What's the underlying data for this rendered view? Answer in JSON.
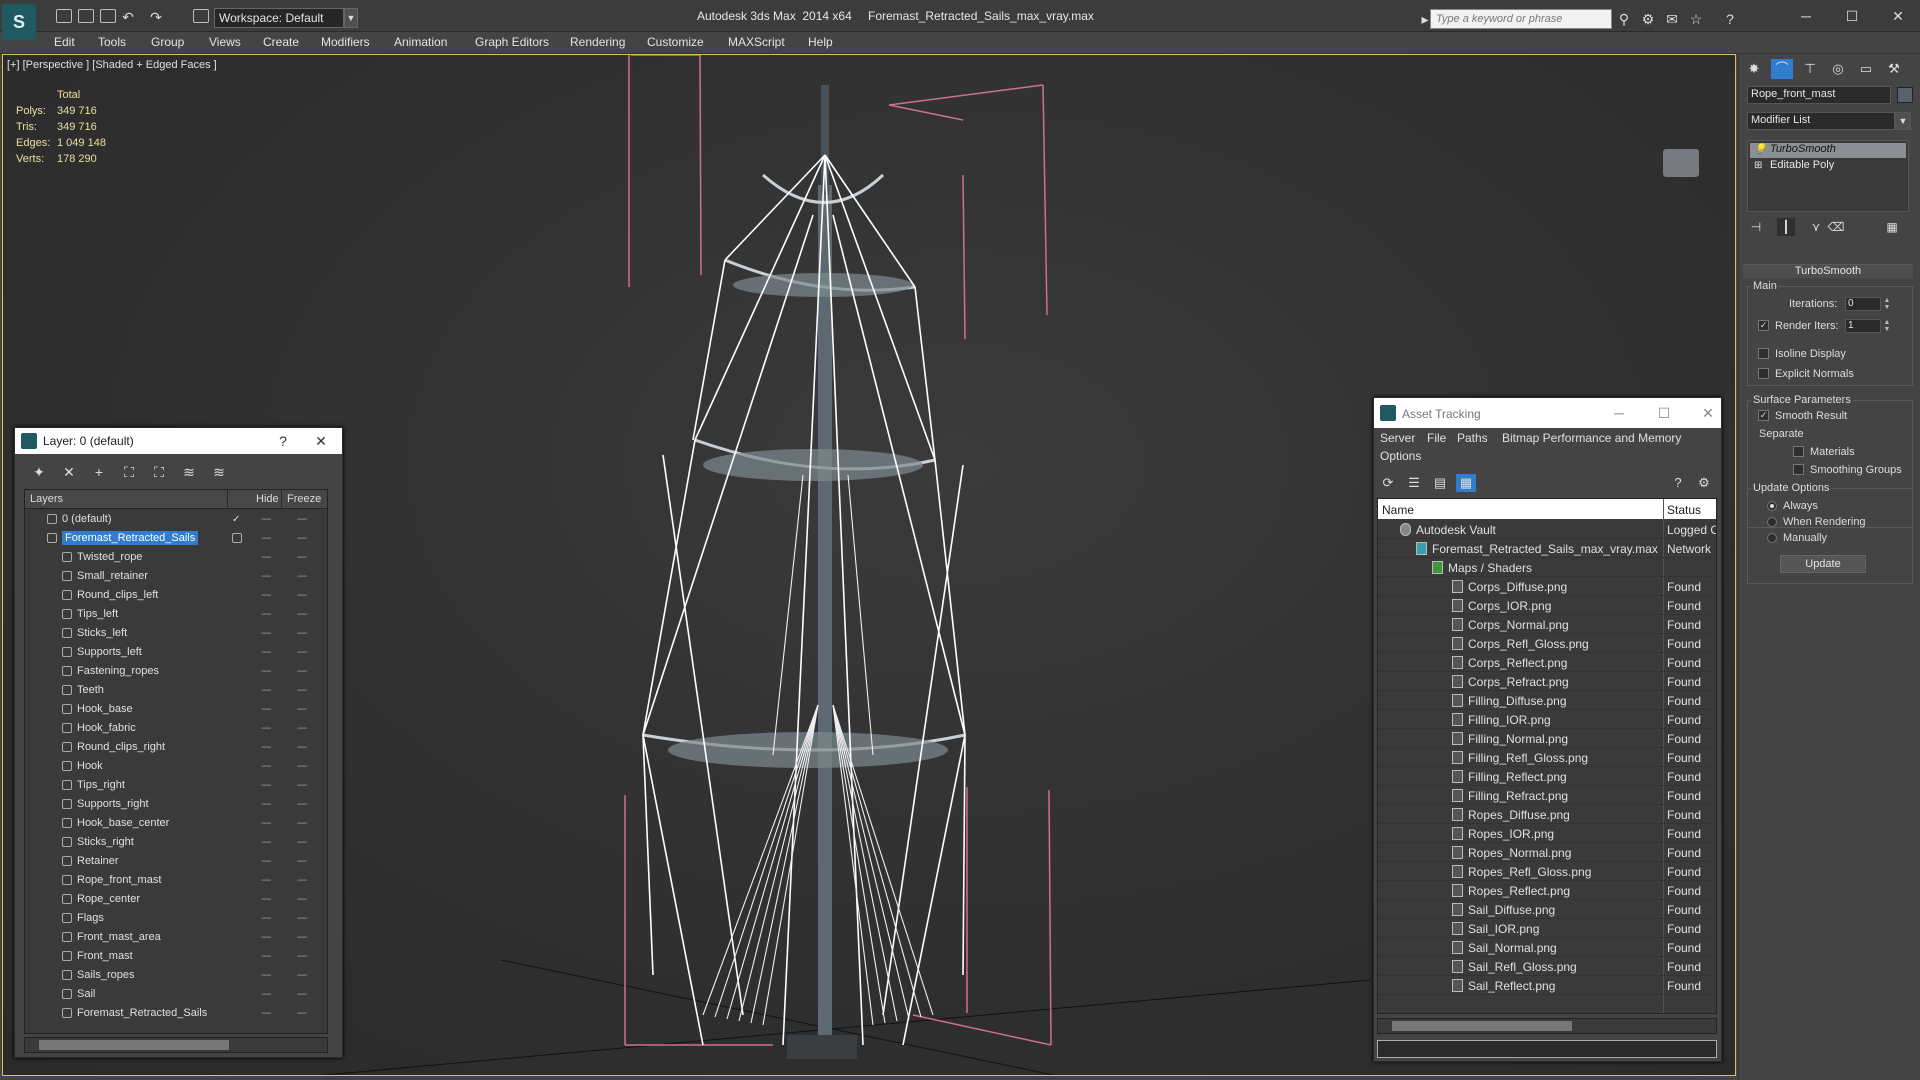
{
  "app": {
    "title": "Autodesk 3ds Max  2014 x64",
    "file": "Foremast_Retracted_Sails_max_vray.max",
    "workspace": "Workspace: Default",
    "search_placeholder": "Type a keyword or phrase"
  },
  "menu": [
    "Edit",
    "Tools",
    "Group",
    "Views",
    "Create",
    "Modifiers",
    "Animation",
    "Graph Editors",
    "Rendering",
    "Customize",
    "MAXScript",
    "Help"
  ],
  "viewport": {
    "label": "[+] [Perspective ] [Shaded + Edged Faces ]",
    "stats": {
      "total_label": "Total",
      "polys_label": "Polys:",
      "polys": "349 716",
      "tris_label": "Tris:",
      "tris": "349 716",
      "edges_label": "Edges:",
      "edges": "1 049 148",
      "verts_label": "Verts:",
      "verts": "178 290"
    }
  },
  "command_panel": {
    "object_name": "Rope_front_mast",
    "modifier_list": "Modifier List",
    "stack": [
      "TurboSmooth",
      "Editable Poly"
    ],
    "turbosmooth": {
      "title": "TurboSmooth",
      "main_group": "Main",
      "iterations_label": "Iterations:",
      "iterations": "0",
      "render_iters_label": "Render Iters:",
      "render_iters": "1",
      "render_iters_checked": true,
      "isoline_label": "Isoline Display",
      "explicit_normals_label": "Explicit Normals",
      "surface_group": "Surface Parameters",
      "smooth_result_label": "Smooth Result",
      "separate_label": "Separate",
      "materials_label": "Materials",
      "smoothing_groups_label": "Smoothing Groups",
      "update_group": "Update Options",
      "always_label": "Always",
      "when_rendering_label": "When Rendering",
      "manually_label": "Manually",
      "update_button": "Update"
    }
  },
  "layer_dialog": {
    "title": "Layer: 0 (default)",
    "col_layers": "Layers",
    "col_hide": "Hide",
    "col_freeze": "Freeze",
    "rows": [
      "0 (default)",
      "Foremast_Retracted_Sails",
      "Twisted_rope",
      "Small_retainer",
      "Round_clips_left",
      "Tips_left",
      "Sticks_left",
      "Supports_left",
      "Fastening_ropes",
      "Teeth",
      "Hook_base",
      "Hook_fabric",
      "Round_clips_right",
      "Hook",
      "Tips_right",
      "Supports_right",
      "Hook_base_center",
      "Sticks_right",
      "Retainer",
      "Rope_front_mast",
      "Rope_center",
      "Flags",
      "Front_mast_area",
      "Front_mast",
      "Sails_ropes",
      "Sail",
      "Foremast_Retracted_Sails"
    ]
  },
  "asset_dialog": {
    "title": "Asset Tracking",
    "menu": [
      "Server",
      "File",
      "Paths",
      "Bitmap Performance and Memory",
      "Options"
    ],
    "col_name": "Name",
    "col_status": "Status",
    "rows": [
      {
        "name": "Autodesk Vault",
        "status": "Logged Out"
      },
      {
        "name": "Foremast_Retracted_Sails_max_vray.max",
        "status": "Network"
      },
      {
        "name": "Maps / Shaders",
        "status": ""
      },
      {
        "name": "Corps_Diffuse.png",
        "status": "Found"
      },
      {
        "name": "Corps_IOR.png",
        "status": "Found"
      },
      {
        "name": "Corps_Normal.png",
        "status": "Found"
      },
      {
        "name": "Corps_Refl_Gloss.png",
        "status": "Found"
      },
      {
        "name": "Corps_Reflect.png",
        "status": "Found"
      },
      {
        "name": "Corps_Refract.png",
        "status": "Found"
      },
      {
        "name": "Filling_Diffuse.png",
        "status": "Found"
      },
      {
        "name": "Filling_IOR.png",
        "status": "Found"
      },
      {
        "name": "Filling_Normal.png",
        "status": "Found"
      },
      {
        "name": "Filling_Refl_Gloss.png",
        "status": "Found"
      },
      {
        "name": "Filling_Reflect.png",
        "status": "Found"
      },
      {
        "name": "Filling_Refract.png",
        "status": "Found"
      },
      {
        "name": "Ropes_Diffuse.png",
        "status": "Found"
      },
      {
        "name": "Ropes_IOR.png",
        "status": "Found"
      },
      {
        "name": "Ropes_Normal.png",
        "status": "Found"
      },
      {
        "name": "Ropes_Refl_Gloss.png",
        "status": "Found"
      },
      {
        "name": "Ropes_Reflect.png",
        "status": "Found"
      },
      {
        "name": "Sail_Diffuse.png",
        "status": "Found"
      },
      {
        "name": "Sail_IOR.png",
        "status": "Found"
      },
      {
        "name": "Sail_Normal.png",
        "status": "Found"
      },
      {
        "name": "Sail_Refl_Gloss.png",
        "status": "Found"
      },
      {
        "name": "Sail_Reflect.png",
        "status": "Found"
      }
    ]
  }
}
